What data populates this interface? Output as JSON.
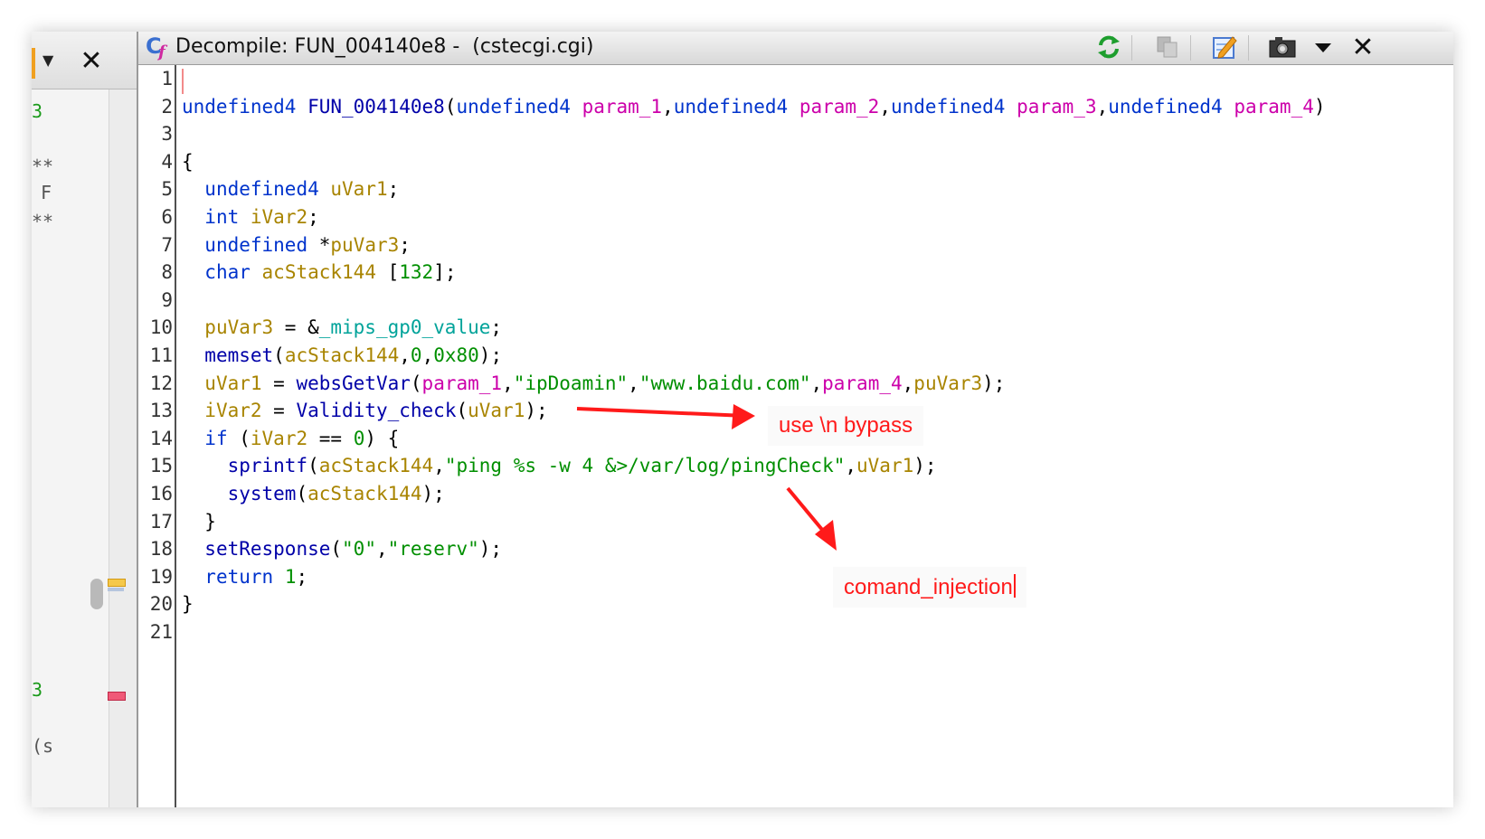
{
  "left_panel": {
    "dropdown_icon": "caret-down",
    "close_label": "✕",
    "fragments": [
      "3",
      "**",
      "F",
      "**",
      "3",
      "(s"
    ]
  },
  "window": {
    "icon": "decompiler-cf-icon",
    "title": "Decompile: FUN_004140e8 -  (cstecgi.cgi)",
    "toolbar": [
      "refresh-icon",
      "copy-icon",
      "edit-icon",
      "snapshot-icon",
      "menu-caret-icon",
      "close-icon"
    ],
    "close_label": "✕"
  },
  "code": {
    "line_numbers": [
      "1",
      "2",
      "3",
      "4",
      "5",
      "6",
      "7",
      "8",
      "9",
      "10",
      "11",
      "12",
      "13",
      "14",
      "15",
      "16",
      "17",
      "18",
      "19",
      "20",
      "21"
    ],
    "lines": [
      "",
      "undefined4 FUN_004140e8(undefined4 param_1,undefined4 param_2,undefined4 param_3,undefined4 param_4)",
      "",
      "{",
      "  undefined4 uVar1;",
      "  int iVar2;",
      "  undefined *puVar3;",
      "  char acStack144 [132];",
      "",
      "  puVar3 = &_mips_gp0_value;",
      "  memset(acStack144,0,0x80);",
      "  uVar1 = websGetVar(param_1,\"ipDoamin\",\"www.baidu.com\",param_4,puVar3);",
      "  iVar2 = Validity_check(uVar1);",
      "  if (iVar2 == 0) {",
      "    sprintf(acStack144,\"ping %s -w 4 &>/var/log/pingCheck\",uVar1);",
      "    system(acStack144);",
      "  }",
      "  setResponse(\"0\",\"reserv\");",
      "  return 1;",
      "}",
      ""
    ],
    "tokens": {
      "l2": [
        "undefined4",
        " ",
        "FUN_004140e8",
        "(",
        "undefined4",
        " ",
        "param_1",
        ",",
        "undefined4",
        " ",
        "param_2",
        ",",
        "undefined4",
        " ",
        "param_3",
        ",",
        "undefined4",
        " ",
        "param_4",
        ")"
      ],
      "l4": [
        "{"
      ],
      "l5": [
        "  ",
        "undefined4",
        " ",
        "uVar1",
        ";"
      ],
      "l6": [
        "  ",
        "int",
        " ",
        "iVar2",
        ";"
      ],
      "l7": [
        "  ",
        "undefined",
        " *",
        "puVar3",
        ";"
      ],
      "l8": [
        "  ",
        "char",
        " ",
        "acStack144",
        " [",
        "132",
        "];"
      ],
      "l10": [
        "  ",
        "puVar3",
        " = &",
        "_mips_gp0_value",
        ";"
      ],
      "l11": [
        "  ",
        "memset",
        "(",
        "acStack144",
        ",",
        "0",
        ",",
        "0x80",
        ");"
      ],
      "l12": [
        "  ",
        "uVar1",
        " = ",
        "websGetVar",
        "(",
        "param_1",
        ",",
        "\"ipDoamin\"",
        ",",
        "\"www.baidu.com\"",
        ",",
        "param_4",
        ",",
        "puVar3",
        ");"
      ],
      "l13": [
        "  ",
        "iVar2",
        " = ",
        "Validity_check",
        "(",
        "uVar1",
        ");"
      ],
      "l14": [
        "  ",
        "if",
        " (",
        "iVar2",
        " == ",
        "0",
        ") {"
      ],
      "l15": [
        "    ",
        "sprintf",
        "(",
        "acStack144",
        ",",
        "\"ping %s -w 4 &>/var/log/pingCheck\"",
        ",",
        "uVar1",
        ");"
      ],
      "l16": [
        "    ",
        "system",
        "(",
        "acStack144",
        ");"
      ],
      "l17": [
        "  }"
      ],
      "l18": [
        "  ",
        "setResponse",
        "(",
        "\"0\"",
        ",",
        "\"reserv\"",
        ");"
      ],
      "l19": [
        "  ",
        "return",
        " ",
        "1",
        ";"
      ],
      "l20": [
        "}"
      ]
    }
  },
  "annotations": {
    "bypass": "use \\n bypass",
    "injection": "comand_injection",
    "color": "#ff1a1a"
  }
}
